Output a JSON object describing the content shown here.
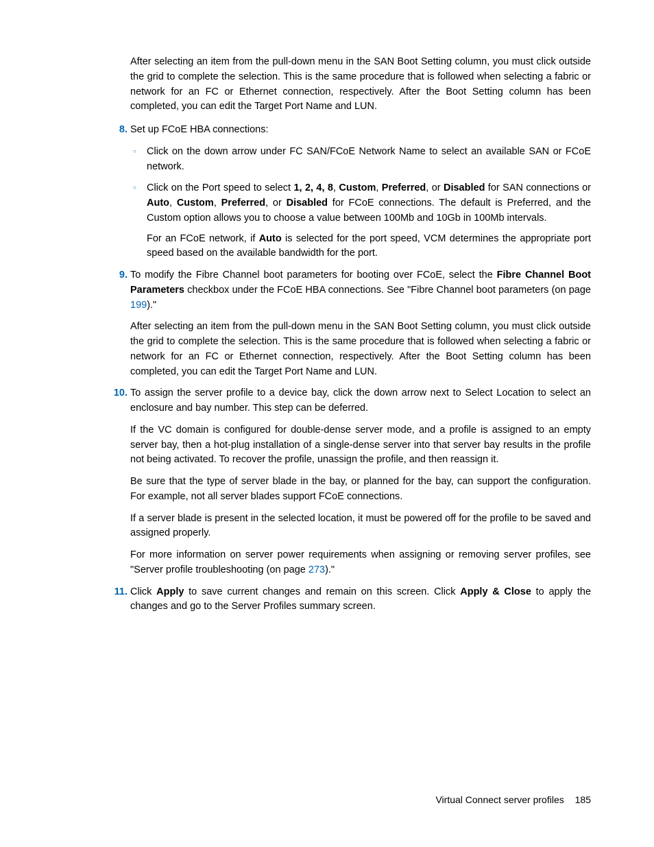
{
  "intro_para": "After selecting an item from the pull-down menu in the SAN Boot Setting column, you must click outside the grid to complete the selection. This is the same procedure that is followed when selecting a fabric or network for an FC or Ethernet connection, respectively. After the Boot Setting column has been completed, you can edit the Target Port Name and LUN.",
  "step8": {
    "num": "8.",
    "lead": "Set up FCoE HBA connections:",
    "sub1": "Click on the down arrow under FC SAN/FCoE Network Name to select an available SAN or FCoE network.",
    "sub2_pre": "Click on the Port speed to select ",
    "sub2_b1": "1, 2, 4, 8",
    "sub2_c1": ", ",
    "sub2_b2": "Custom",
    "sub2_c2": ", ",
    "sub2_b3": "Preferred",
    "sub2_c3": ", or ",
    "sub2_b4": "Disabled",
    "sub2_mid": " for SAN connections or ",
    "sub2_b5": "Auto",
    "sub2_c4": ", ",
    "sub2_b6": "Custom",
    "sub2_c5": ", ",
    "sub2_b7": "Preferred",
    "sub2_c6": ", or ",
    "sub2_b8": "Disabled",
    "sub2_end": " for FCoE connections. The default is Preferred, and the Custom option allows you to choose a value between 100Mb and 10Gb in 100Mb intervals.",
    "sub2_p2_pre": "For an FCoE network, if ",
    "sub2_p2_b": "Auto",
    "sub2_p2_end": " is selected for the port speed, VCM determines the appropriate port speed based on the available bandwidth for the port."
  },
  "step9": {
    "num": "9.",
    "p1_pre": "To modify the Fibre Channel boot parameters for booting over FCoE, select the ",
    "p1_b1": "Fibre Channel Boot Parameters",
    "p1_mid": " checkbox under the FCoE HBA connections. See \"Fibre Channel boot parameters (on page ",
    "p1_link": "199",
    "p1_end": ").\"",
    "p2": "After selecting an item from the pull-down menu in the SAN Boot Setting column, you must click outside the grid to complete the selection. This is the same procedure that is followed when selecting a fabric or network for an FC or Ethernet connection, respectively. After the Boot Setting column has been completed, you can edit the Target Port Name and LUN."
  },
  "step10": {
    "num": "10.",
    "p1": "To assign the server profile to a device bay, click the down arrow next to Select Location to select an enclosure and bay number. This step can be deferred.",
    "p2": "If the VC domain is configured for double-dense server mode, and a profile is assigned to an empty server bay, then a hot-plug installation of a single-dense server into that server bay results in the profile not being activated. To recover the profile, unassign the profile, and then reassign it.",
    "p3": "Be sure that the type of server blade in the bay, or planned for the bay, can support the configuration. For example, not all server blades support FCoE connections.",
    "p4": "If a server blade is present in the selected location, it must be powered off for the profile to be saved and assigned properly.",
    "p5_pre": "For more information on server power requirements when assigning or removing server profiles, see \"Server profile troubleshooting (on page ",
    "p5_link": "273",
    "p5_end": ").\""
  },
  "step11": {
    "num": "11.",
    "pre": "Click ",
    "b1": "Apply",
    "mid1": " to save current changes and remain on this screen. Click ",
    "b2": "Apply & Close",
    "end": " to apply the changes and go to the Server Profiles summary screen."
  },
  "footer": {
    "title": "Virtual Connect server profiles",
    "page": "185"
  }
}
